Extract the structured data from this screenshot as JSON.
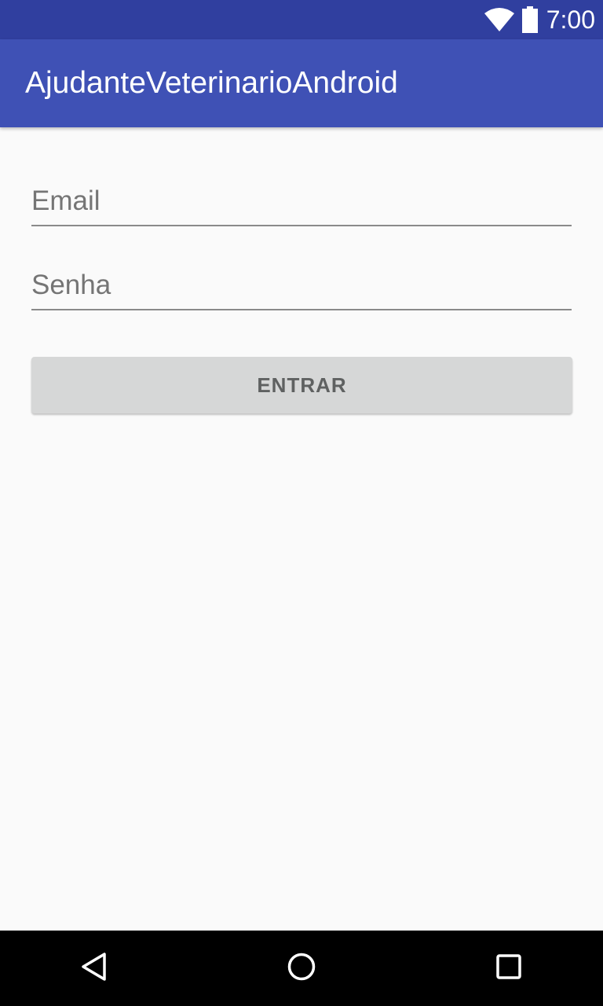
{
  "status_bar": {
    "time": "7:00",
    "icons": [
      "wifi-icon",
      "battery-icon"
    ]
  },
  "app_bar": {
    "title": "AjudanteVeterinarioAndroid"
  },
  "form": {
    "email": {
      "value": "",
      "placeholder": "Email"
    },
    "password": {
      "value": "",
      "placeholder": "Senha"
    },
    "submit_label": "ENTRAR"
  },
  "nav_bar": {
    "icons": [
      "back-icon",
      "home-icon",
      "recents-icon"
    ]
  },
  "colors": {
    "status_bar": "#303f9f",
    "primary": "#3f51b5",
    "background": "#fafafa",
    "button": "#d6d7d7",
    "nav_bar": "#000000"
  }
}
